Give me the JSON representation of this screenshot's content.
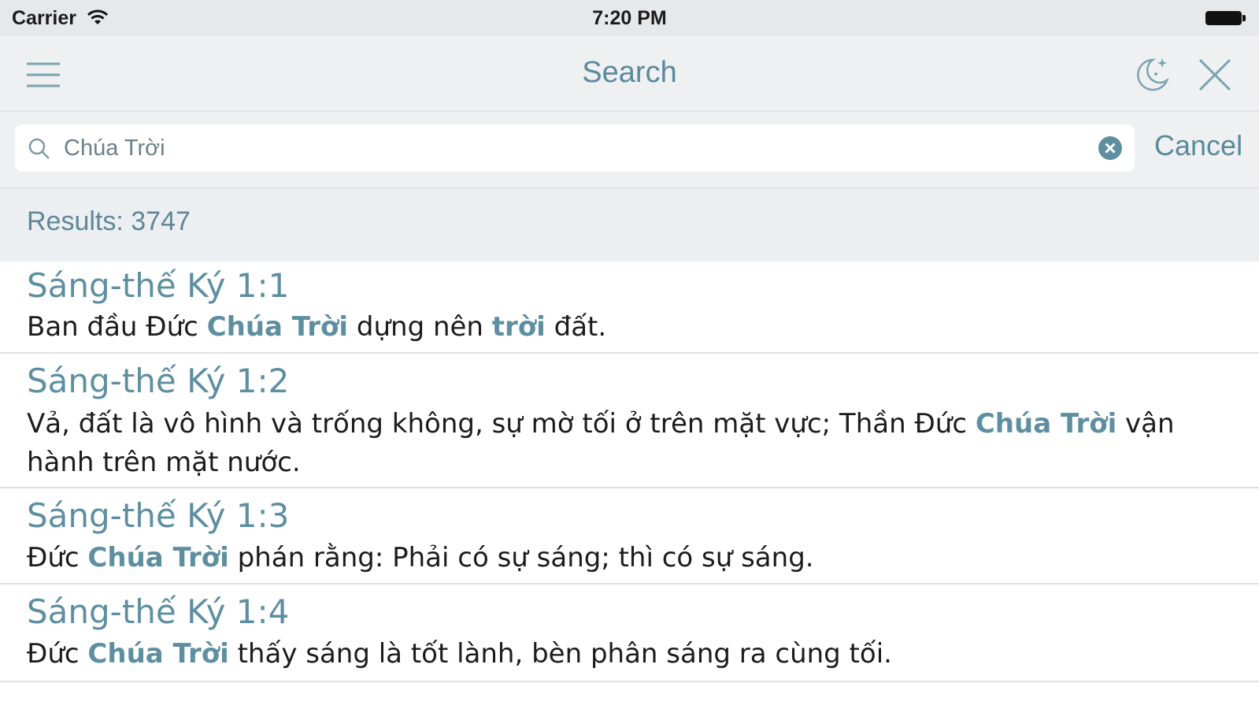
{
  "status_bar": {
    "carrier": "Carrier",
    "time": "7:20 PM"
  },
  "nav": {
    "title": "Search",
    "icons": [
      "menu-icon",
      "night-mode-icon",
      "close-icon"
    ]
  },
  "search": {
    "query": "Chúa Trời",
    "cancel_label": "Cancel"
  },
  "results": {
    "count_label": "Results: 3747",
    "items": [
      {
        "ref": "Sáng-thế Ký 1:1",
        "segments": [
          {
            "t": "Ban đầu Đức "
          },
          {
            "t": "Chúa Trời",
            "hl": true
          },
          {
            "t": " dựng nên "
          },
          {
            "t": "trời",
            "hl": true
          },
          {
            "t": " đất."
          }
        ]
      },
      {
        "ref": "Sáng-thế Ký 1:2",
        "segments": [
          {
            "t": "Vả, đất là vô hình và trống không, sự mờ tối ở trên mặt vực; Thần Đức "
          },
          {
            "t": "Chúa Trời",
            "hl": true
          },
          {
            "t": " vận hành trên mặt nước."
          }
        ]
      },
      {
        "ref": "Sáng-thế Ký 1:3",
        "segments": [
          {
            "t": "Đức "
          },
          {
            "t": "Chúa Trời",
            "hl": true
          },
          {
            "t": " phán rằng: Phải có sự sáng; thì có sự sáng."
          }
        ]
      },
      {
        "ref": "Sáng-thế Ký 1:4",
        "segments": [
          {
            "t": "Đức "
          },
          {
            "t": "Chúa Trời",
            "hl": true
          },
          {
            "t": " thấy sáng là tốt lành, bèn phân sáng ra cùng tối."
          }
        ]
      }
    ]
  },
  "colors": {
    "accent": "#5e8fa0",
    "bar_background": "#eef0f2",
    "text": "#1c1c1c"
  }
}
